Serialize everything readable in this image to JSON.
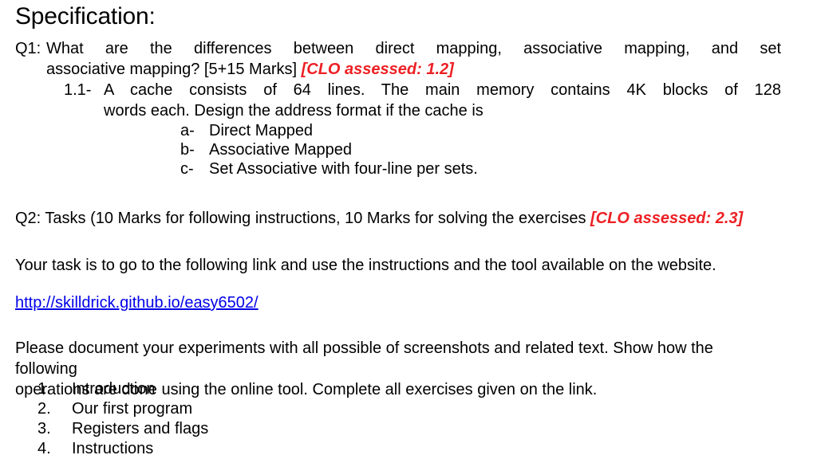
{
  "document": {
    "title": "Specification:",
    "background_color": "#ffffff",
    "text_color": "#000000",
    "accent_red": "#ED2024",
    "link_color": "#0000E8"
  },
  "q1": {
    "label": "Q1:",
    "line1": "What are the differences between direct mapping, associative mapping, and set",
    "line2_text": "associative mapping? [5+15 Marks] ",
    "line2_clo": "[CLO assessed: 1.2]"
  },
  "sub11": {
    "label": "1.1-",
    "line1": "A cache consists of 64 lines. The main memory contains 4K blocks of 128",
    "line2": "words each. Design the address format if the cache is"
  },
  "abc_list": [
    {
      "marker": "a-",
      "text": "Direct Mapped"
    },
    {
      "marker": "b-",
      "text": "Associative Mapped"
    },
    {
      "marker": "c-",
      "text": "Set Associative with four-line per sets."
    }
  ],
  "q2": {
    "text": "Q2: Tasks (10 Marks for following instructions, 10 Marks for solving the exercises ",
    "clo": "[CLO assessed: 2.3]"
  },
  "intro_paragraph": "Your task is to go to the following link and use the instructions and the tool available on the website.",
  "link": {
    "text": "http://skilldrick.github.io/easy6502/",
    "href": "http://skilldrick.github.io/easy6502/"
  },
  "instructions_paragraph": {
    "line1": "Please document your experiments with all possible of screenshots and related text. Show how the following",
    "line2": "operations are done using the online tool. Complete all exercises given on the link."
  },
  "numbered_list": [
    {
      "marker": "1.",
      "text": "Introduction"
    },
    {
      "marker": "2.",
      "text": "Our first program"
    },
    {
      "marker": "3.",
      "text": "Registers and flags"
    },
    {
      "marker": "4.",
      "text": "Instructions"
    }
  ]
}
